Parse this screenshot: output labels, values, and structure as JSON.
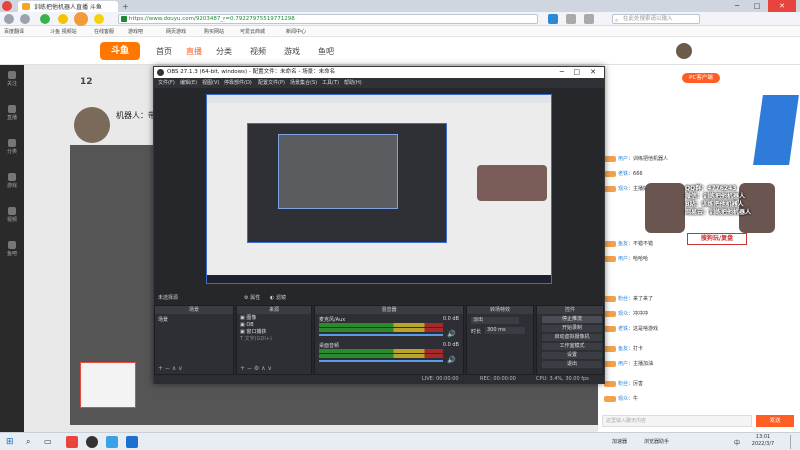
{
  "browser": {
    "tab_title": "训练把他机器人直播 斗鱼",
    "url": "https://www.douyu.com/9203487_r=0.79227975519771298",
    "search_placeholder": "在此处搜索请以输入",
    "bookmarks": [
      "百度翻译",
      "斗鱼 视频站",
      "在线客服",
      "游戏吧",
      "网页游戏",
      "购买网站",
      "可爱云商城",
      "新闻中心"
    ]
  },
  "site": {
    "logo": "斗鱼",
    "nav": [
      "首页",
      "直播",
      "分类",
      "视频",
      "游戏",
      "鱼吧"
    ],
    "follow_count": "12",
    "streamer_name": "机器人：带",
    "left_trail": [
      "关注",
      "直播",
      "分类",
      "游戏",
      "视频",
      "鱼吧"
    ],
    "chat_header": "PC客户端",
    "chat_lines": [
      {
        "name": "用户",
        "text": "训练把他机器人"
      },
      {
        "name": "老铁",
        "text": "666"
      },
      {
        "name": "观众",
        "text": "主播好强"
      },
      {
        "name": "鱼友",
        "text": "不错不错"
      },
      {
        "name": "用户",
        "text": "哈哈哈"
      },
      {
        "name": "粉丝",
        "text": "来了来了"
      },
      {
        "name": "观众",
        "text": "冲冲冲"
      },
      {
        "name": "老铁",
        "text": "这是啥游戏"
      },
      {
        "name": "鱼友",
        "text": "打卡"
      },
      {
        "name": "用户",
        "text": "主播加油"
      },
      {
        "name": "粉丝",
        "text": "厉害"
      },
      {
        "name": "观众",
        "text": "牛"
      }
    ],
    "overlay_lines": [
      "QQ群：4776243",
      "微信：训练把他机器人",
      "B站：训练把他机器人",
      "网易云：训练把他机器人"
    ],
    "overlay_tag": "搜狗玩/复盘",
    "chat_input_placeholder": "这里输入聊天内容",
    "send_label": "发送"
  },
  "obs": {
    "title": "OBS 27.1.3 (64-bit, windows) - 配置文件：未命名 - 场景：未命名",
    "menu": [
      "文件(F)",
      "编辑(E)",
      "视图(V)",
      "停靠部件(D)",
      "配置文件(P)",
      "场景集合(S)",
      "工具(T)",
      "帮助(H)"
    ],
    "props_label": "属性",
    "filters_label": "滤镜",
    "no_source": "未选择源",
    "docks": {
      "scenes": {
        "title": "场景",
        "items": [
          "场景"
        ]
      },
      "sources": {
        "title": "来源",
        "items": [
          "图像",
          "OB",
          "窗口捕获",
          "文字(GDI+)"
        ]
      },
      "mixer": {
        "title": "混音器",
        "channels": [
          {
            "name": "麦克风/Aux",
            "db": "0.0 dB"
          },
          {
            "name": "桌面音频",
            "db": "0.0 dB"
          }
        ]
      },
      "transitions": {
        "title": "转场特效",
        "type": "淡出",
        "duration_label": "时长",
        "duration": "300 ms"
      },
      "controls": {
        "title": "控件",
        "buttons": [
          "停止推流",
          "开始录制",
          "启动虚拟摄像机",
          "工作室模式",
          "设置",
          "退出"
        ]
      }
    },
    "status": {
      "live": "LIVE: 00:00:00",
      "rec": "REC: 00:00:00",
      "cpu": "CPU: 3.4%, 30.00 fps"
    }
  },
  "taskbar": {
    "time": "13:01",
    "date": "2022/3/7",
    "lang": "中",
    "tray": [
      "加速器",
      "浏览器助手"
    ]
  }
}
